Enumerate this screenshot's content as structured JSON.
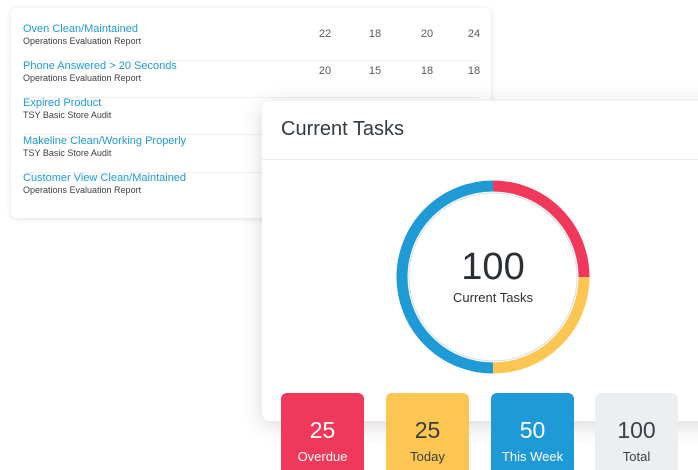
{
  "report": {
    "rows": [
      {
        "title": "Oven Clean/Maintained",
        "subtitle": "Operations Evaluation Report",
        "values": [
          "22",
          "18",
          "20",
          "24"
        ]
      },
      {
        "title": "Phone Answered > 20 Seconds",
        "subtitle": "Operations Evaluation Report",
        "values": [
          "20",
          "15",
          "18",
          "18"
        ]
      },
      {
        "title": "Expired Product",
        "subtitle": "TSY Basic Store Audit",
        "values": []
      },
      {
        "title": "Makeline Clean/Working Properly",
        "subtitle": "TSY Basic Store Audit",
        "values": []
      },
      {
        "title": "Customer View Clean/Maintained",
        "subtitle": "Operations Evaluation Report",
        "values": []
      }
    ]
  },
  "tasks": {
    "title": "Current Tasks",
    "total": "100",
    "total_label": "Current Tasks",
    "tiles": [
      {
        "count": "25",
        "label": "Overdue"
      },
      {
        "count": "25",
        "label": "Today"
      },
      {
        "count": "50",
        "label": "This Week"
      },
      {
        "count": "100",
        "label": "Total"
      }
    ]
  },
  "colors": {
    "overdue": "#f0395a",
    "today": "#fdc652",
    "this_week": "#1e9ad6",
    "total": "#eceff2",
    "link": "#1e9ad6"
  }
}
